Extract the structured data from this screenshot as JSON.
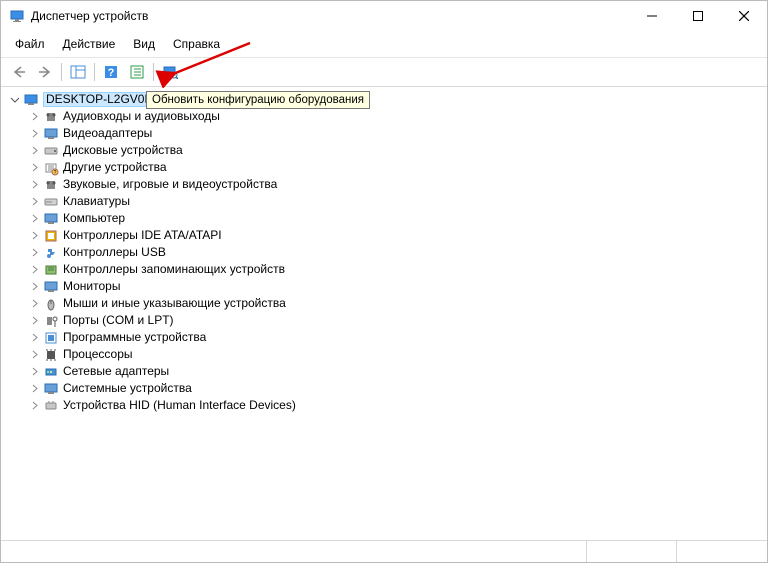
{
  "window": {
    "title": "Диспетчер устройств"
  },
  "menu": {
    "file": "Файл",
    "action": "Действие",
    "view": "Вид",
    "help": "Справка"
  },
  "toolbar": {
    "tooltip": "Обновить конфигурацию оборудования"
  },
  "tree": {
    "root": "DESKTOP-L2GV0M",
    "items": [
      "Аудиовходы и аудиовыходы",
      "Видеоадаптеры",
      "Дисковые устройства",
      "Другие устройства",
      "Звуковые, игровые и видеоустройства",
      "Клавиатуры",
      "Компьютер",
      "Контроллеры IDE ATA/ATAPI",
      "Контроллеры USB",
      "Контроллеры запоминающих устройств",
      "Мониторы",
      "Мыши и иные указывающие устройства",
      "Порты (COM и LPT)",
      "Программные устройства",
      "Процессоры",
      "Сетевые адаптеры",
      "Системные устройства",
      "Устройства HID (Human Interface Devices)"
    ]
  }
}
